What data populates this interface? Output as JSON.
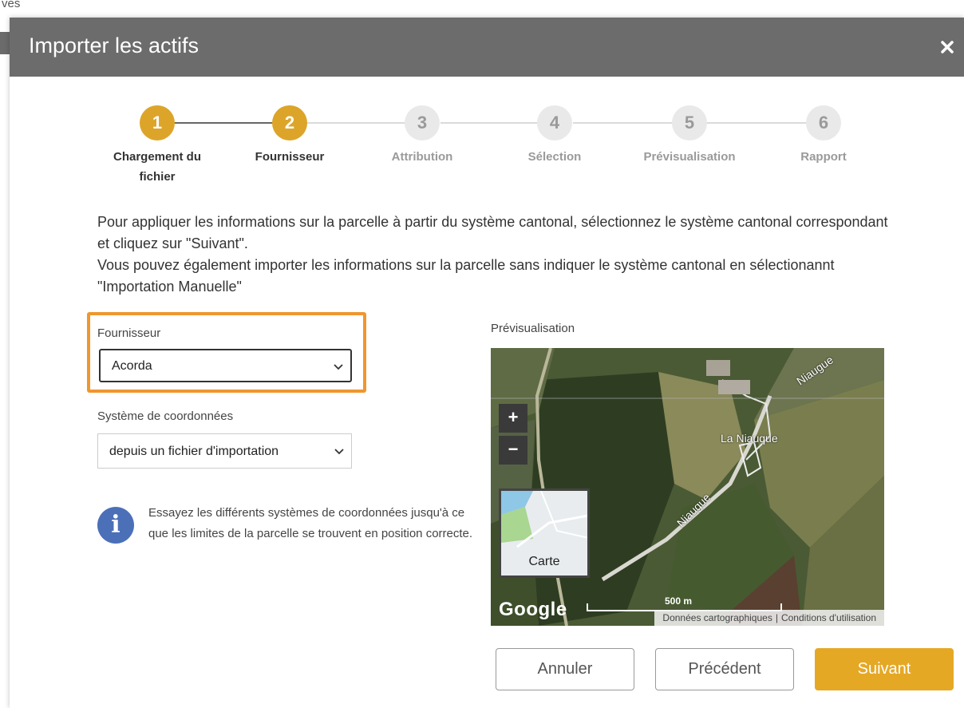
{
  "background": {
    "top_text": "ves"
  },
  "modal": {
    "title": "Importer les actifs",
    "close_icon": "close-icon"
  },
  "stepper": {
    "steps": [
      {
        "number": "1",
        "label": "Chargement du fichier",
        "state": "done"
      },
      {
        "number": "2",
        "label": "Fournisseur",
        "state": "active"
      },
      {
        "number": "3",
        "label": "Attribution",
        "state": "pending"
      },
      {
        "number": "4",
        "label": "Sélection",
        "state": "pending"
      },
      {
        "number": "5",
        "label": "Prévisualisation",
        "state": "pending"
      },
      {
        "number": "6",
        "label": "Rapport",
        "state": "pending"
      }
    ]
  },
  "description": {
    "line1": "Pour appliquer les informations sur la parcelle à partir du système cantonal, sélectionnez le système cantonal correspondant et cliquez sur \"Suivant\".",
    "line2": "Vous pouvez également importer les informations sur la parcelle sans indiquer le système cantonal en sélectionannt \"Importation Manuelle\""
  },
  "form": {
    "provider_label": "Fournisseur",
    "provider_value": "Acorda",
    "coords_label": "Système de coordonnées",
    "coords_value": "depuis un fichier d'importation",
    "info_text": "Essayez les différents systèmes de coordonnées jusqu'à ce que les limites de la parcelle se trouvent en position correcte."
  },
  "preview": {
    "label": "Prévisualisation",
    "zoom_in": "+",
    "zoom_out": "−",
    "map_type_label": "Carte",
    "google_logo": "Google",
    "scale": "500 m",
    "attribution_data": "Données cartographiques",
    "attribution_terms": "Conditions d'utilisation",
    "place_1": "Niaugue",
    "place_2": "La Niauque",
    "place_3": "Niaugue"
  },
  "footer": {
    "cancel": "Annuler",
    "previous": "Précédent",
    "next": "Suivant"
  },
  "colors": {
    "accent": "#e5a825",
    "header": "#6c6c6c",
    "highlight": "#f0962e",
    "info": "#4b70b8"
  }
}
